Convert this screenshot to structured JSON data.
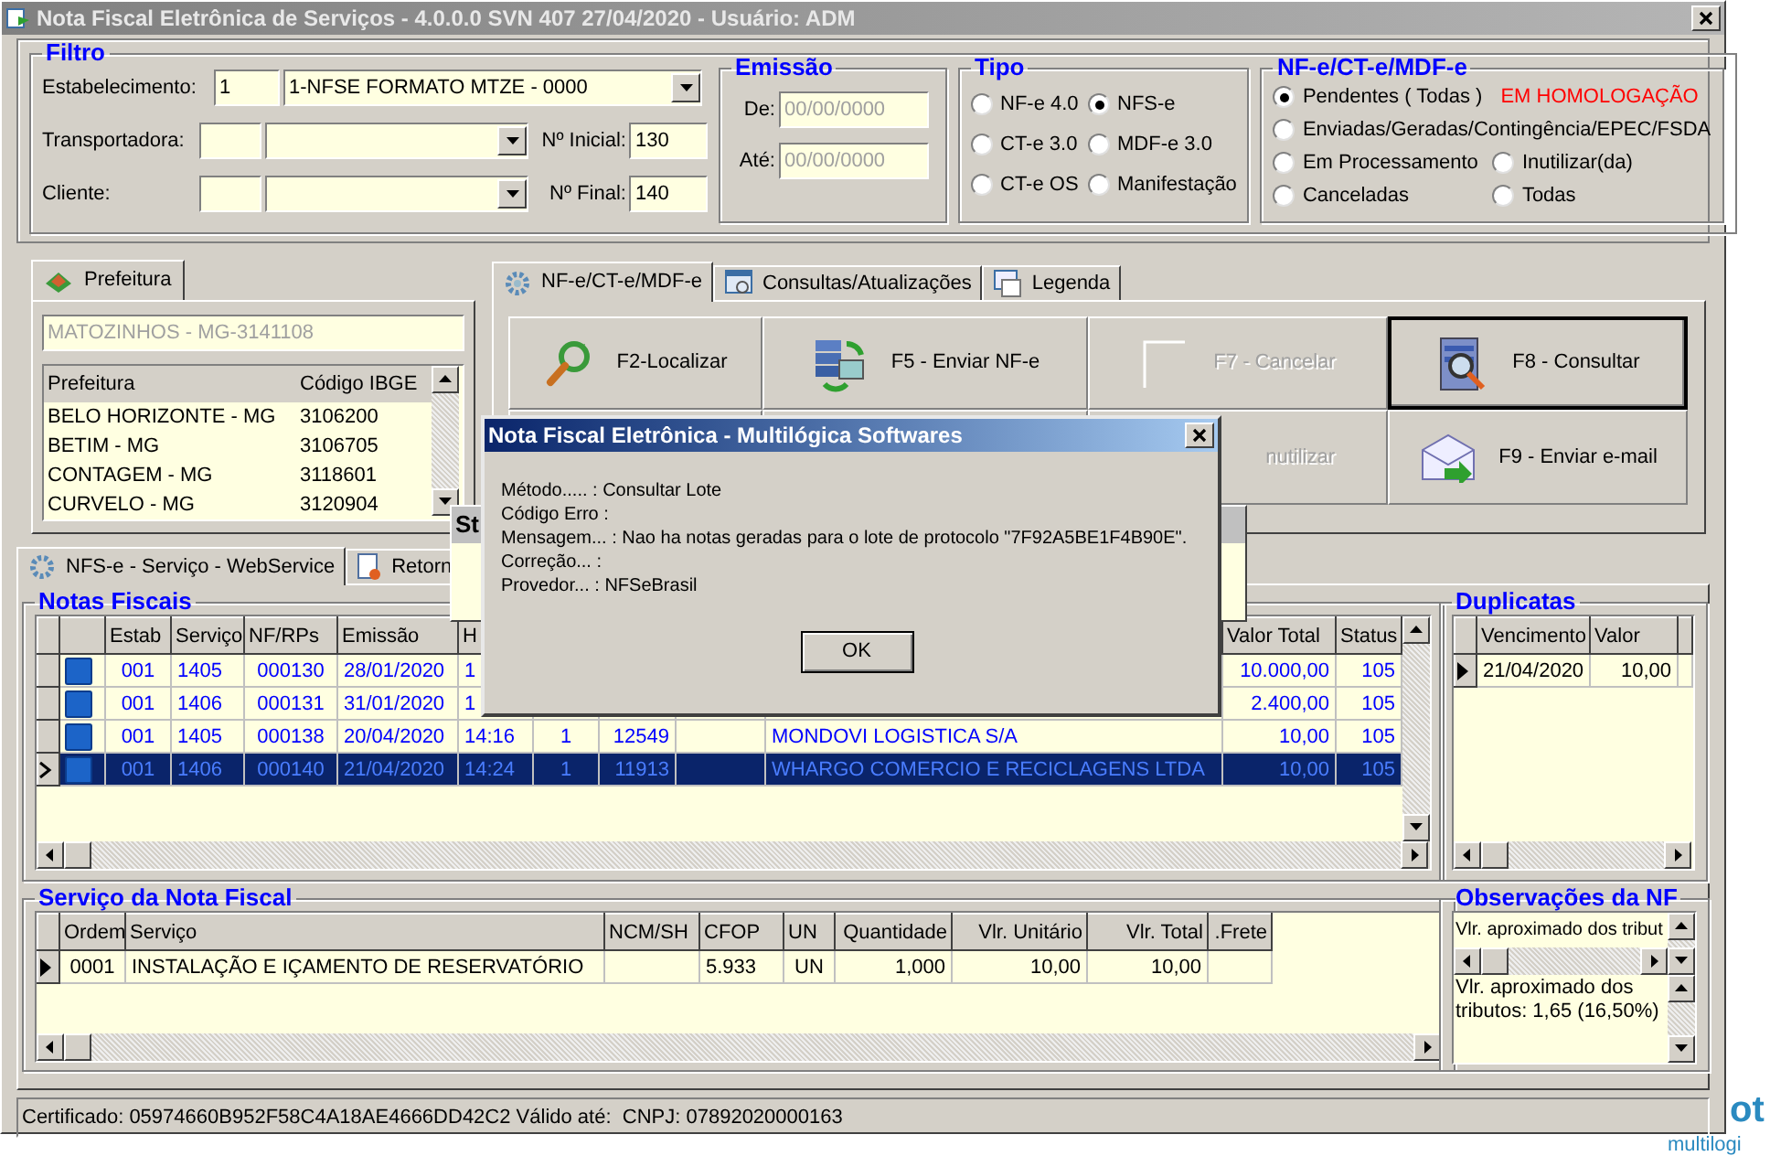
{
  "window": {
    "title": "Nota Fiscal Eletrônica de Serviços - 4.0.0.0 SVN 407 27/04/2020 - Usuário: ADM"
  },
  "filtro": {
    "title": "Filtro",
    "estabelecimento": {
      "label": "Estabelecimento:",
      "code": "1",
      "value": "1-NFSE FORMATO MTZE - 0000"
    },
    "transportadora": {
      "label": "Transportadora:"
    },
    "cliente": {
      "label": "Cliente:"
    },
    "numero_inicial": {
      "label": "Nº Inicial:",
      "value": "130"
    },
    "numero_final": {
      "label": "Nº Final:",
      "value": "140"
    }
  },
  "emissao": {
    "title": "Emissão",
    "fields": [
      {
        "label": "De:",
        "value": "00/00/0000",
        "disabled": true
      },
      {
        "label": "Até:",
        "value": "00/00/0000",
        "disabled": true
      }
    ]
  },
  "tipo": {
    "title": "Tipo",
    "options": [
      {
        "label": "NF-e 4.0",
        "selected": false
      },
      {
        "label": "NFS-e",
        "selected": true
      },
      {
        "label": "CT-e 3.0",
        "selected": false
      },
      {
        "label": "MDF-e 3.0",
        "selected": false
      },
      {
        "label": "CT-e OS",
        "selected": false
      },
      {
        "label": "Manifestação",
        "selected": false
      }
    ]
  },
  "situacao": {
    "title": "NF-e/CT-e/MDF-e",
    "warning": "EM HOMOLOGAÇÃO",
    "options": [
      {
        "label": "Pendentes ( Todas )",
        "selected": true
      },
      {
        "label": "Enviadas/Geradas/Contingência/EPEC/FSDA",
        "selected": false
      },
      {
        "label": "Em Processamento",
        "selected": false
      },
      {
        "label": "Inutilizar(da)",
        "selected": false
      },
      {
        "label": "Canceladas",
        "selected": false
      },
      {
        "label": "Todas",
        "selected": false
      }
    ]
  },
  "prefeitura": {
    "tab": "Prefeitura",
    "current": "MATOZINHOS - MG-3141108",
    "columns": [
      "Prefeitura",
      "Código IBGE"
    ],
    "rows": [
      [
        "BELO HORIZONTE - MG",
        "3106200"
      ],
      [
        "BETIM - MG",
        "3106705"
      ],
      [
        "CONTAGEM - MG",
        "3118601"
      ],
      [
        "CURVELO - MG",
        "3120904"
      ]
    ]
  },
  "action_tabs": [
    {
      "label": "NF-e/CT-e/MDF-e",
      "selected": true
    },
    {
      "label": "Consultas/Atualizações",
      "selected": false
    },
    {
      "label": "Legenda",
      "selected": false
    }
  ],
  "actions": [
    {
      "kind": "button",
      "label": "F2-Localizar",
      "disabled": false,
      "focused": false
    },
    {
      "kind": "button",
      "label": "F5 - Enviar NF-e",
      "disabled": false,
      "focused": false
    },
    {
      "kind": "button",
      "label": "F7 - Cancelar",
      "disabled": true,
      "focused": false
    },
    {
      "kind": "button",
      "label": "F8 - Consultar",
      "disabled": false,
      "focused": true
    },
    {
      "kind": "covered"
    },
    {
      "kind": "covered"
    },
    {
      "kind": "button",
      "label": "nutilizar",
      "disabled": true,
      "focused": false
    },
    {
      "kind": "button",
      "label": "F9 - Enviar e-mail",
      "disabled": false,
      "focused": false
    }
  ],
  "bottom_tabs": [
    {
      "label": "NFS-e - Serviço - WebService",
      "selected": true
    },
    {
      "label": "Retorn",
      "selected": false
    }
  ],
  "notas": {
    "title": "Notas Fiscais",
    "columns": [
      "Estab",
      "Serviço",
      "NF/RPs",
      "Emissão",
      "H",
      null,
      null,
      null,
      null,
      "Valor Total",
      "Status"
    ],
    "rows": [
      {
        "selected": false,
        "cells": [
          "001",
          "1405",
          "000130",
          "28/01/2020",
          "1",
          null,
          null,
          null,
          null,
          "10.000,00",
          "105"
        ]
      },
      {
        "selected": false,
        "cells": [
          "001",
          "1406",
          "000131",
          "31/01/2020",
          "1",
          null,
          null,
          null,
          null,
          "2.400,00",
          "105"
        ]
      },
      {
        "selected": false,
        "cells": [
          "001",
          "1405",
          "000138",
          "20/04/2020",
          "14:16",
          "1",
          "12549",
          null,
          "MONDOVI LOGISTICA S/A",
          "10,00",
          "105"
        ]
      },
      {
        "selected": true,
        "cells": [
          "001",
          "1406",
          "000140",
          "21/04/2020",
          "14:24",
          "1",
          "11913",
          null,
          "WHARGO COMERCIO E RECICLAGENS LTDA",
          "10,00",
          "105"
        ]
      }
    ]
  },
  "duplicatas": {
    "title": "Duplicatas",
    "columns": [
      "Vencimento",
      "Valor"
    ],
    "rows": [
      {
        "selected": true,
        "cells": [
          "21/04/2020",
          "10,00"
        ]
      }
    ]
  },
  "servico": {
    "title": "Serviço da Nota Fiscal",
    "columns": [
      "Ordem",
      "Serviço",
      "NCM/SH",
      "CFOP",
      "UN",
      "Quantidade",
      "Vlr. Unitário",
      "Vlr. Total",
      ".Frete"
    ],
    "rows": [
      {
        "selected": true,
        "cells": [
          "0001",
          "INSTALAÇÃO E IÇAMENTO DE RESERVATÓRIO",
          null,
          "5.933",
          "UN",
          "1,000",
          "10,00",
          "10,00",
          null
        ]
      }
    ]
  },
  "observacoes": {
    "title": "Observações da NF",
    "summary": "Vlr. aproximado dos tribut",
    "text": "Vlr. aproximado dos tributos: 1,65 (16,50%)"
  },
  "status_bar": "Certificado: 05974660B952F58C4A18AE4666DD42C2 Válido até:  CNPJ: 07892020000163",
  "background_window": {
    "title": "St"
  },
  "dialog": {
    "title": "Nota Fiscal Eletrônica - Multilógica Softwares",
    "lines": [
      "Método..... : Consultar Lote",
      "Código Erro :",
      "Mensagem... : Nao ha notas geradas para o lote de protocolo \"7F92A5BE1F4B90E\".",
      "Correção... :",
      "Provedor... : NFSeBrasil"
    ],
    "button": "OK"
  },
  "desktop": {
    "logo": "ot",
    "caption": "multilogi"
  }
}
